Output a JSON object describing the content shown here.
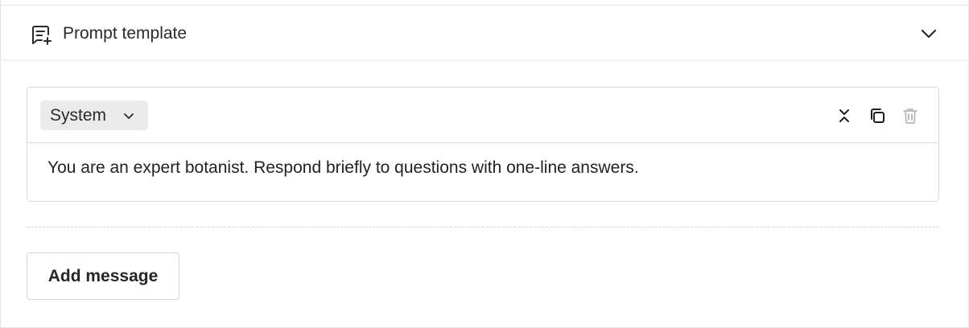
{
  "section": {
    "title": "Prompt template",
    "icon": "chat-plus-icon",
    "toggle_icon": "chevron-down-icon"
  },
  "message": {
    "role": "System",
    "role_icon": "chevron-down-icon",
    "content": "You are an expert botanist. Respond briefly to questions with one-line answers.",
    "tools": [
      "collapse-icon",
      "copy-icon",
      "delete-icon"
    ]
  },
  "actions": {
    "add_message_label": "Add message"
  },
  "colors": {
    "border": "#dcdcdc",
    "role_bg": "#ebebeb",
    "text": "#222222",
    "disabled_icon": "#b8b8b8"
  }
}
